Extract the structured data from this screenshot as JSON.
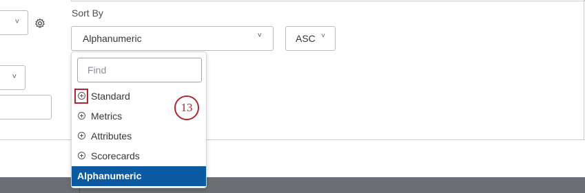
{
  "sort_by": {
    "label": "Sort By",
    "field_value": "Alphanumeric",
    "order_value": "ASC"
  },
  "dropdown": {
    "search_placeholder": "Find",
    "groups": [
      {
        "label": "Standard"
      },
      {
        "label": "Metrics"
      },
      {
        "label": "Attributes"
      },
      {
        "label": "Scorecards"
      }
    ],
    "selected_option": "Alphanumeric"
  },
  "annotation": {
    "callout_number": "13",
    "highlight_color": "#b0252f"
  },
  "colors": {
    "selected_bg": "#0b5aa2"
  }
}
